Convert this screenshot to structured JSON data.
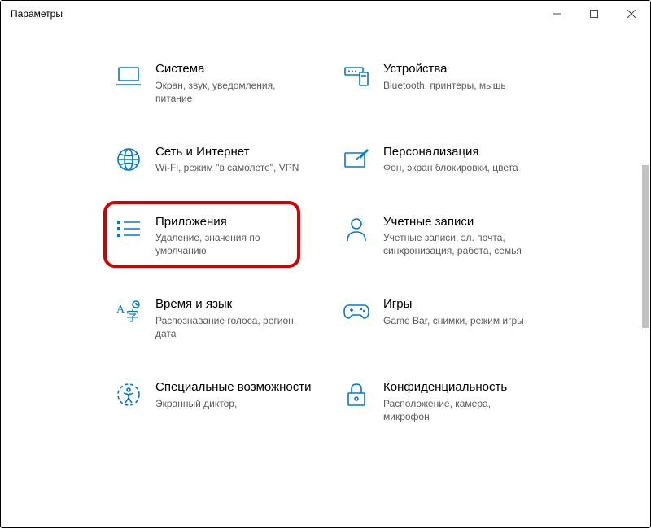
{
  "window": {
    "title": "Параметры"
  },
  "items": [
    {
      "title": "Система",
      "desc": "Экран, звук, уведомления, питание"
    },
    {
      "title": "Устройства",
      "desc": "Bluetooth, принтеры, мышь"
    },
    {
      "title": "Сеть и Интернет",
      "desc": "Wi-Fi, режим \"в самолете\", VPN"
    },
    {
      "title": "Персонализация",
      "desc": "Фон, экран блокировки, цвета"
    },
    {
      "title": "Приложения",
      "desc": "Удаление, значения по умолчанию"
    },
    {
      "title": "Учетные записи",
      "desc": "Учетные записи, эл. почта, синхронизация, работа, семья"
    },
    {
      "title": "Время и язык",
      "desc": "Распознавание голоса, регион, дата"
    },
    {
      "title": "Игры",
      "desc": "Game Bar, снимки, режим игры"
    },
    {
      "title": "Специальные возможности",
      "desc": "Экранный диктор,"
    },
    {
      "title": "Конфиденциальность",
      "desc": "Расположение, камера, микрофон"
    }
  ],
  "colors": {
    "accent": "#0078d7",
    "highlight": "#d40000"
  }
}
